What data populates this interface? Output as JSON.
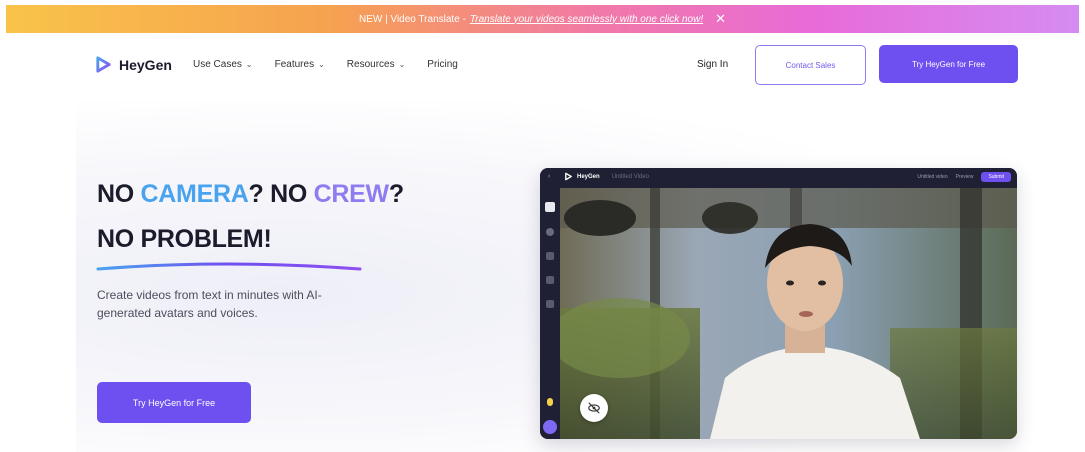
{
  "announcement": {
    "prefix": "NEW | Video Translate - ",
    "link": "Translate your videos seamlessly with one click now!",
    "close_icon": "close-icon"
  },
  "header": {
    "logo_text": "HeyGen",
    "nav": [
      {
        "label": "Use Cases",
        "has_dropdown": true
      },
      {
        "label": "Features",
        "has_dropdown": true
      },
      {
        "label": "Resources",
        "has_dropdown": true
      },
      {
        "label": "Pricing",
        "has_dropdown": false
      }
    ],
    "sign_in": "Sign In",
    "contact_sales": "Contact Sales",
    "try_free": "Try HeyGen for Free"
  },
  "hero": {
    "headline_parts": {
      "no1": "NO ",
      "camera": "CAMERA",
      "q1": "? NO ",
      "crew": "CREW",
      "q2": "?",
      "line2": "NO PROBLEM!"
    },
    "subtext": "Create videos from text in minutes with AI-generated avatars and voices.",
    "cta": "Try HeyGen for Free"
  },
  "preview": {
    "logo_text": "HeyGen",
    "project_label": "Untitled Video",
    "right_items": [
      "Untitled video",
      "Preview"
    ],
    "primary_action": "Submit"
  },
  "colors": {
    "accent": "#6e4ff0",
    "camera": "#4aa3ee",
    "crew": "#8e7cf0"
  }
}
